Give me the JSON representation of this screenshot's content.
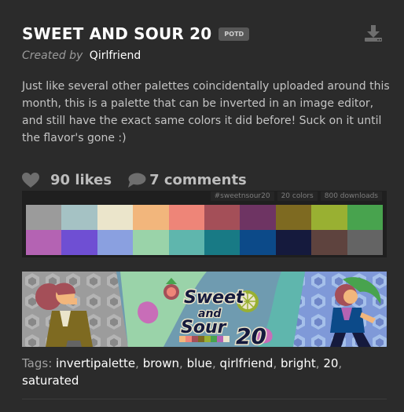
{
  "palette": {
    "title": "SWEET AND SOUR 20",
    "badge": "POTD",
    "created_by_label": "Created by",
    "author": "Qirlfriend",
    "description": "Just like several other palettes coincidentally uploaded around this month, this is a palette that can be inverted in an image editor, and still have the exact same colors it did before! Suck on it until the flavor's gone :)",
    "likes": "90 likes",
    "comments": "7 comments",
    "meta": [
      "#sweetnsour20",
      "20 colors",
      "800 downloads"
    ],
    "colors": [
      "#9b9b9b",
      "#a5c2c4",
      "#ebe5cb",
      "#f2b67c",
      "#ee8578",
      "#a44f58",
      "#6e3463",
      "#7e6a21",
      "#99b032",
      "#48a34e",
      "#b463b3",
      "#6f4fd3",
      "#8aa0e0",
      "#9ad3a9",
      "#5fb6ad",
      "#187a85",
      "#0c4a89",
      "#151a3d",
      "#5e433e",
      "#646464"
    ],
    "banner_text": [
      "Sweet",
      "and",
      "Sour",
      "20"
    ],
    "tags_label": "Tags:",
    "tags": [
      "invertipalette",
      "brown",
      "blue",
      "qirlfriend",
      "bright",
      "20",
      "saturated"
    ]
  },
  "icons": {
    "download": "download-icon",
    "likes": "heart-icon",
    "comments": "speech-bubble-icon"
  }
}
